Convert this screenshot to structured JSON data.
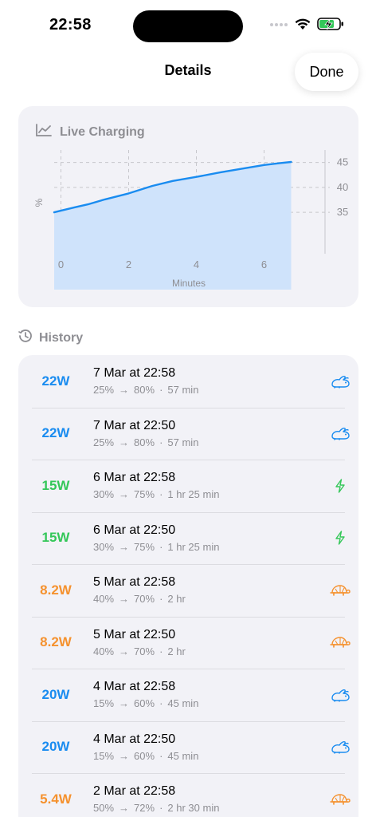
{
  "status_bar": {
    "time": "22:58"
  },
  "nav": {
    "title": "Details",
    "done_label": "Done"
  },
  "chart": {
    "header": "Live Charging",
    "fill_color": "#cfe3fb",
    "line_color": "#1a8cf0",
    "chart_data": {
      "type": "area",
      "xlabel": "Minutes",
      "ylabel": "%",
      "x_ticks": [
        0,
        2,
        4,
        6
      ],
      "y_ticks": [
        35,
        40,
        45
      ],
      "xlim": [
        -0.2,
        7.8
      ],
      "ylim": [
        27.5,
        47.5
      ],
      "y_axis_side": "right",
      "grid": true,
      "series": [
        {
          "x": [
            -0.2,
            0.4,
            0.8,
            1.3,
            2.0,
            2.7,
            3.3,
            4.0,
            4.7,
            5.4,
            6.0,
            6.5,
            6.8
          ],
          "y": [
            35.0,
            36.0,
            36.6,
            37.6,
            38.8,
            40.3,
            41.3,
            42.1,
            43.0,
            43.8,
            44.5,
            44.9,
            45.1
          ]
        }
      ]
    }
  },
  "history": {
    "header": "History",
    "rows": [
      {
        "watts": "22W",
        "color": "#1a8cf0",
        "date": "7 Mar at 22:58",
        "from": "25%",
        "to": "80%",
        "duration": "57 min",
        "icon": "rabbit-icon"
      },
      {
        "watts": "22W",
        "color": "#1a8cf0",
        "date": "7 Mar at 22:50",
        "from": "25%",
        "to": "80%",
        "duration": "57 min",
        "icon": "rabbit-icon"
      },
      {
        "watts": "15W",
        "color": "#34c759",
        "date": "6 Mar at 22:58",
        "from": "30%",
        "to": "75%",
        "duration": "1 hr 25 min",
        "icon": "bolt-icon"
      },
      {
        "watts": "15W",
        "color": "#34c759",
        "date": "6 Mar at 22:50",
        "from": "30%",
        "to": "75%",
        "duration": "1 hr 25 min",
        "icon": "bolt-icon"
      },
      {
        "watts": "8.2W",
        "color": "#f5922f",
        "date": "5 Mar at 22:58",
        "from": "40%",
        "to": "70%",
        "duration": "2 hr",
        "icon": "turtle-icon"
      },
      {
        "watts": "8.2W",
        "color": "#f5922f",
        "date": "5 Mar at 22:50",
        "from": "40%",
        "to": "70%",
        "duration": "2 hr",
        "icon": "turtle-icon"
      },
      {
        "watts": "20W",
        "color": "#1a8cf0",
        "date": "4 Mar at 22:58",
        "from": "15%",
        "to": "60%",
        "duration": "45 min",
        "icon": "rabbit-icon"
      },
      {
        "watts": "20W",
        "color": "#1a8cf0",
        "date": "4 Mar at 22:50",
        "from": "15%",
        "to": "60%",
        "duration": "45 min",
        "icon": "rabbit-icon"
      },
      {
        "watts": "5.4W",
        "color": "#f5922f",
        "date": "2 Mar at 22:58",
        "from": "50%",
        "to": "72%",
        "duration": "2 hr 30 min",
        "icon": "turtle-icon"
      }
    ]
  }
}
